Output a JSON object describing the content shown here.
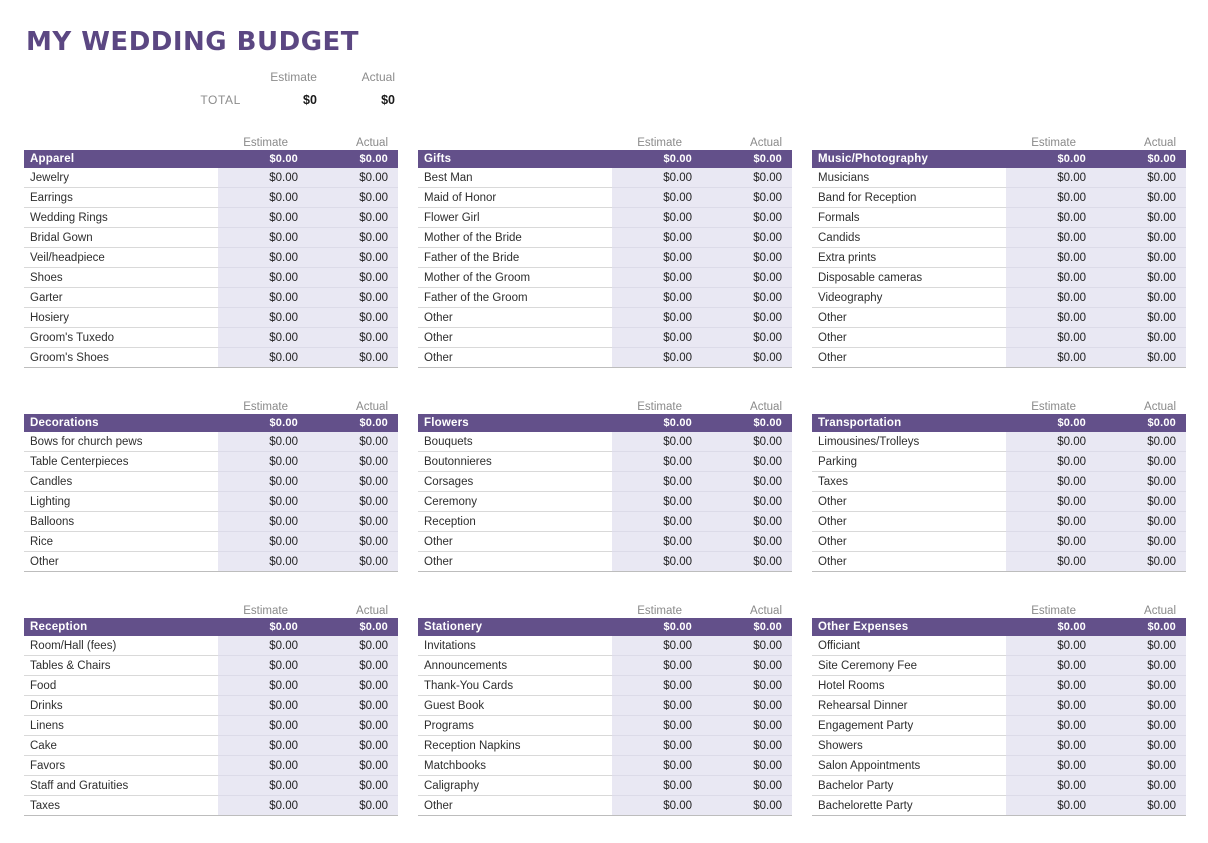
{
  "page_title": "MY WEDDING BUDGET",
  "colors": {
    "title": "#5b4782",
    "section_header_bg": "#63508a",
    "amount_column_bg": "#e9e8f3"
  },
  "total_summary": {
    "estimate_label": "Estimate",
    "actual_label": "Actual",
    "total_label": "TOTAL",
    "estimate_value": "$0",
    "actual_value": "$0"
  },
  "column_headers": {
    "estimate": "Estimate",
    "actual": "Actual"
  },
  "sections": [
    {
      "name": "Apparel",
      "estimate": "$0.00",
      "actual": "$0.00",
      "items": [
        {
          "label": "Jewelry",
          "estimate": "$0.00",
          "actual": "$0.00"
        },
        {
          "label": "Earrings",
          "estimate": "$0.00",
          "actual": "$0.00"
        },
        {
          "label": "Wedding Rings",
          "estimate": "$0.00",
          "actual": "$0.00"
        },
        {
          "label": "Bridal Gown",
          "estimate": "$0.00",
          "actual": "$0.00"
        },
        {
          "label": "Veil/headpiece",
          "estimate": "$0.00",
          "actual": "$0.00"
        },
        {
          "label": "Shoes",
          "estimate": "$0.00",
          "actual": "$0.00"
        },
        {
          "label": "Garter",
          "estimate": "$0.00",
          "actual": "$0.00"
        },
        {
          "label": "Hosiery",
          "estimate": "$0.00",
          "actual": "$0.00"
        },
        {
          "label": "Groom's Tuxedo",
          "estimate": "$0.00",
          "actual": "$0.00"
        },
        {
          "label": "Groom's Shoes",
          "estimate": "$0.00",
          "actual": "$0.00"
        }
      ]
    },
    {
      "name": "Gifts",
      "estimate": "$0.00",
      "actual": "$0.00",
      "items": [
        {
          "label": "Best Man",
          "estimate": "$0.00",
          "actual": "$0.00"
        },
        {
          "label": "Maid of Honor",
          "estimate": "$0.00",
          "actual": "$0.00"
        },
        {
          "label": "Flower Girl",
          "estimate": "$0.00",
          "actual": "$0.00"
        },
        {
          "label": "Mother of the Bride",
          "estimate": "$0.00",
          "actual": "$0.00"
        },
        {
          "label": "Father of the Bride",
          "estimate": "$0.00",
          "actual": "$0.00"
        },
        {
          "label": "Mother of the Groom",
          "estimate": "$0.00",
          "actual": "$0.00"
        },
        {
          "label": "Father of the Groom",
          "estimate": "$0.00",
          "actual": "$0.00"
        },
        {
          "label": "Other",
          "estimate": "$0.00",
          "actual": "$0.00"
        },
        {
          "label": "Other",
          "estimate": "$0.00",
          "actual": "$0.00"
        },
        {
          "label": "Other",
          "estimate": "$0.00",
          "actual": "$0.00"
        }
      ]
    },
    {
      "name": "Music/Photography",
      "estimate": "$0.00",
      "actual": "$0.00",
      "items": [
        {
          "label": "Musicians",
          "estimate": "$0.00",
          "actual": "$0.00"
        },
        {
          "label": "Band for Reception",
          "estimate": "$0.00",
          "actual": "$0.00"
        },
        {
          "label": "Formals",
          "estimate": "$0.00",
          "actual": "$0.00"
        },
        {
          "label": "Candids",
          "estimate": "$0.00",
          "actual": "$0.00"
        },
        {
          "label": "Extra prints",
          "estimate": "$0.00",
          "actual": "$0.00"
        },
        {
          "label": "Disposable cameras",
          "estimate": "$0.00",
          "actual": "$0.00"
        },
        {
          "label": "Videography",
          "estimate": "$0.00",
          "actual": "$0.00"
        },
        {
          "label": "Other",
          "estimate": "$0.00",
          "actual": "$0.00"
        },
        {
          "label": "Other",
          "estimate": "$0.00",
          "actual": "$0.00"
        },
        {
          "label": "Other",
          "estimate": "$0.00",
          "actual": "$0.00"
        }
      ]
    },
    {
      "name": "Decorations",
      "estimate": "$0.00",
      "actual": "$0.00",
      "items": [
        {
          "label": "Bows for church pews",
          "estimate": "$0.00",
          "actual": "$0.00"
        },
        {
          "label": "Table Centerpieces",
          "estimate": "$0.00",
          "actual": "$0.00"
        },
        {
          "label": "Candles",
          "estimate": "$0.00",
          "actual": "$0.00"
        },
        {
          "label": "Lighting",
          "estimate": "$0.00",
          "actual": "$0.00"
        },
        {
          "label": "Balloons",
          "estimate": "$0.00",
          "actual": "$0.00"
        },
        {
          "label": "Rice",
          "estimate": "$0.00",
          "actual": "$0.00"
        },
        {
          "label": "Other",
          "estimate": "$0.00",
          "actual": "$0.00"
        }
      ]
    },
    {
      "name": "Flowers",
      "estimate": "$0.00",
      "actual": "$0.00",
      "items": [
        {
          "label": "Bouquets",
          "estimate": "$0.00",
          "actual": "$0.00"
        },
        {
          "label": "Boutonnieres",
          "estimate": "$0.00",
          "actual": "$0.00"
        },
        {
          "label": "Corsages",
          "estimate": "$0.00",
          "actual": "$0.00"
        },
        {
          "label": "Ceremony",
          "estimate": "$0.00",
          "actual": "$0.00"
        },
        {
          "label": "Reception",
          "estimate": "$0.00",
          "actual": "$0.00"
        },
        {
          "label": "Other",
          "estimate": "$0.00",
          "actual": "$0.00"
        },
        {
          "label": "Other",
          "estimate": "$0.00",
          "actual": "$0.00"
        }
      ]
    },
    {
      "name": "Transportation",
      "estimate": "$0.00",
      "actual": "$0.00",
      "items": [
        {
          "label": "Limousines/Trolleys",
          "estimate": "$0.00",
          "actual": "$0.00"
        },
        {
          "label": "Parking",
          "estimate": "$0.00",
          "actual": "$0.00"
        },
        {
          "label": "Taxes",
          "estimate": "$0.00",
          "actual": "$0.00"
        },
        {
          "label": "Other",
          "estimate": "$0.00",
          "actual": "$0.00"
        },
        {
          "label": "Other",
          "estimate": "$0.00",
          "actual": "$0.00"
        },
        {
          "label": "Other",
          "estimate": "$0.00",
          "actual": "$0.00"
        },
        {
          "label": "Other",
          "estimate": "$0.00",
          "actual": "$0.00"
        }
      ]
    },
    {
      "name": "Reception",
      "estimate": "$0.00",
      "actual": "$0.00",
      "items": [
        {
          "label": "Room/Hall (fees)",
          "estimate": "$0.00",
          "actual": "$0.00"
        },
        {
          "label": "Tables & Chairs",
          "estimate": "$0.00",
          "actual": "$0.00"
        },
        {
          "label": "Food",
          "estimate": "$0.00",
          "actual": "$0.00"
        },
        {
          "label": "Drinks",
          "estimate": "$0.00",
          "actual": "$0.00"
        },
        {
          "label": "Linens",
          "estimate": "$0.00",
          "actual": "$0.00"
        },
        {
          "label": "Cake",
          "estimate": "$0.00",
          "actual": "$0.00"
        },
        {
          "label": "Favors",
          "estimate": "$0.00",
          "actual": "$0.00"
        },
        {
          "label": "Staff and Gratuities",
          "estimate": "$0.00",
          "actual": "$0.00"
        },
        {
          "label": "Taxes",
          "estimate": "$0.00",
          "actual": "$0.00"
        }
      ]
    },
    {
      "name": "Stationery",
      "estimate": "$0.00",
      "actual": "$0.00",
      "items": [
        {
          "label": "Invitations",
          "estimate": "$0.00",
          "actual": "$0.00"
        },
        {
          "label": "Announcements",
          "estimate": "$0.00",
          "actual": "$0.00"
        },
        {
          "label": "Thank-You Cards",
          "estimate": "$0.00",
          "actual": "$0.00"
        },
        {
          "label": "Guest Book",
          "estimate": "$0.00",
          "actual": "$0.00"
        },
        {
          "label": "Programs",
          "estimate": "$0.00",
          "actual": "$0.00"
        },
        {
          "label": "Reception Napkins",
          "estimate": "$0.00",
          "actual": "$0.00"
        },
        {
          "label": "Matchbooks",
          "estimate": "$0.00",
          "actual": "$0.00"
        },
        {
          "label": "Caligraphy",
          "estimate": "$0.00",
          "actual": "$0.00"
        },
        {
          "label": "Other",
          "estimate": "$0.00",
          "actual": "$0.00"
        }
      ]
    },
    {
      "name": "Other Expenses",
      "estimate": "$0.00",
      "actual": "$0.00",
      "items": [
        {
          "label": "Officiant",
          "estimate": "$0.00",
          "actual": "$0.00"
        },
        {
          "label": "Site Ceremony Fee",
          "estimate": "$0.00",
          "actual": "$0.00"
        },
        {
          "label": "Hotel Rooms",
          "estimate": "$0.00",
          "actual": "$0.00"
        },
        {
          "label": "Rehearsal Dinner",
          "estimate": "$0.00",
          "actual": "$0.00"
        },
        {
          "label": "Engagement Party",
          "estimate": "$0.00",
          "actual": "$0.00"
        },
        {
          "label": "Showers",
          "estimate": "$0.00",
          "actual": "$0.00"
        },
        {
          "label": "Salon Appointments",
          "estimate": "$0.00",
          "actual": "$0.00"
        },
        {
          "label": "Bachelor Party",
          "estimate": "$0.00",
          "actual": "$0.00"
        },
        {
          "label": "Bachelorette Party",
          "estimate": "$0.00",
          "actual": "$0.00"
        }
      ]
    }
  ]
}
